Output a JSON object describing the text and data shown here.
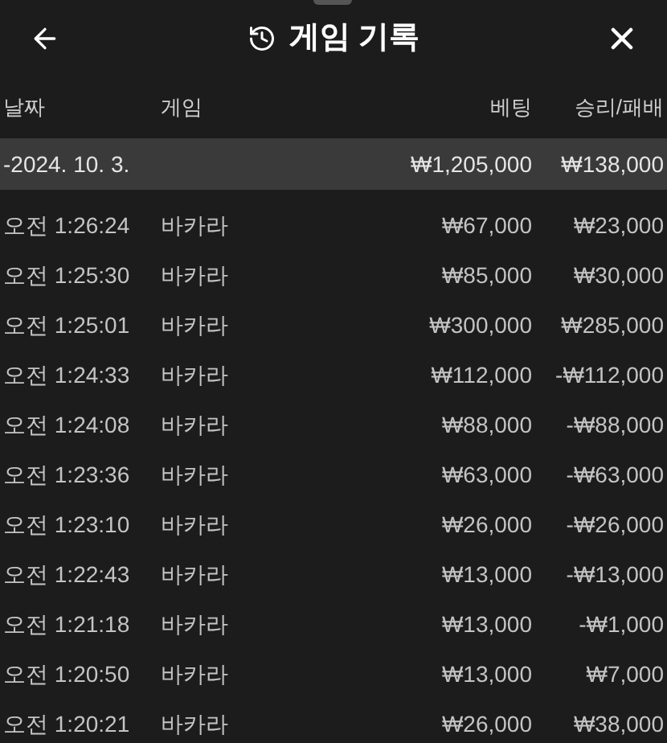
{
  "header": {
    "title": "게임 기록"
  },
  "table": {
    "columns": [
      "날짜",
      "게임",
      "베팅",
      "승리/패배"
    ],
    "group": {
      "date": "-2024. 10. 3.",
      "bet": "₩1,205,000",
      "result": "₩138,000"
    },
    "rows": [
      {
        "time": "오전 1:26:24",
        "game": "바카라",
        "bet": "₩67,000",
        "result": "₩23,000"
      },
      {
        "time": "오전 1:25:30",
        "game": "바카라",
        "bet": "₩85,000",
        "result": "₩30,000"
      },
      {
        "time": "오전 1:25:01",
        "game": "바카라",
        "bet": "₩300,000",
        "result": "₩285,000"
      },
      {
        "time": "오전 1:24:33",
        "game": "바카라",
        "bet": "₩112,000",
        "result": "-₩112,000"
      },
      {
        "time": "오전 1:24:08",
        "game": "바카라",
        "bet": "₩88,000",
        "result": "-₩88,000"
      },
      {
        "time": "오전 1:23:36",
        "game": "바카라",
        "bet": "₩63,000",
        "result": "-₩63,000"
      },
      {
        "time": "오전 1:23:10",
        "game": "바카라",
        "bet": "₩26,000",
        "result": "-₩26,000"
      },
      {
        "time": "오전 1:22:43",
        "game": "바카라",
        "bet": "₩13,000",
        "result": "-₩13,000"
      },
      {
        "time": "오전 1:21:18",
        "game": "바카라",
        "bet": "₩13,000",
        "result": "-₩1,000"
      },
      {
        "time": "오전 1:20:50",
        "game": "바카라",
        "bet": "₩13,000",
        "result": "₩7,000"
      },
      {
        "time": "오전 1:20:21",
        "game": "바카라",
        "bet": "₩26,000",
        "result": "₩38,000"
      }
    ]
  }
}
